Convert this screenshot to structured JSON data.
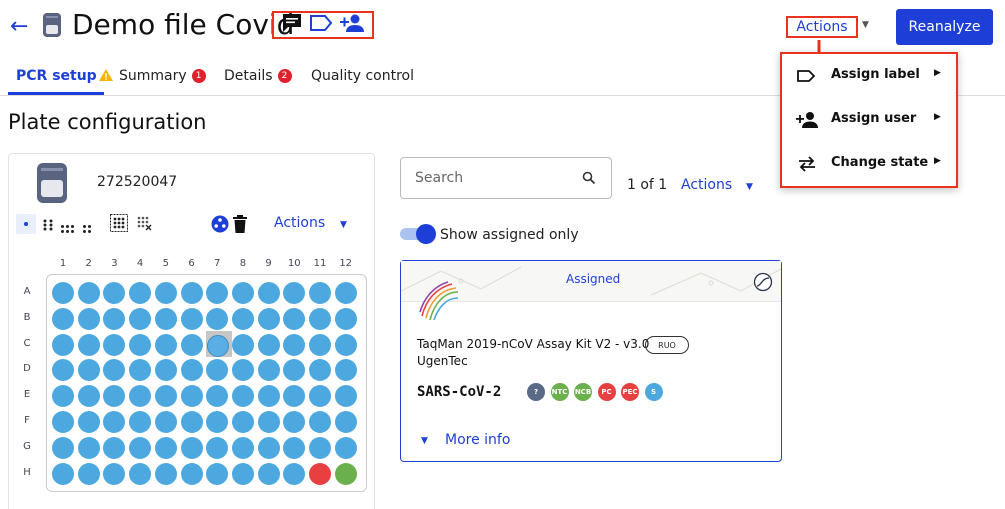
{
  "header": {
    "back_icon": "arrow-left-icon",
    "title": "Demo file Covid",
    "actions_label": "Actions",
    "reanalyze_label": "Reanalyze",
    "icons": [
      "comment-icon",
      "label-icon",
      "add-user-icon"
    ]
  },
  "tabs": [
    {
      "label": "PCR setup",
      "warning": true,
      "active": true
    },
    {
      "label": "Summary",
      "badge": "1"
    },
    {
      "label": "Details",
      "badge": "2"
    },
    {
      "label": "Quality control"
    }
  ],
  "section_title": "Plate configuration",
  "plate": {
    "id": "272520047",
    "actions_label": "Actions",
    "columns": [
      "1",
      "2",
      "3",
      "4",
      "5",
      "6",
      "7",
      "8",
      "9",
      "10",
      "11",
      "12"
    ],
    "rows": [
      "A",
      "B",
      "C",
      "D",
      "E",
      "F",
      "G",
      "H"
    ],
    "special_wells": {
      "selected": "C7",
      "red": "H11",
      "green": "H12"
    },
    "colors": {
      "well": "#4da8e0",
      "red": "#e84040",
      "green": "#6ab04c"
    }
  },
  "search": {
    "placeholder": "Search",
    "page_count": "1 of 1",
    "actions_label": "Actions"
  },
  "toggle": {
    "label": "Show assigned only",
    "on": true
  },
  "card": {
    "status": "Assigned",
    "kit_name": "TaqMan 2019-nCoV Assay Kit V2 - v3.0",
    "tag": "RUO",
    "vendor": "UgenTec",
    "target": "SARS-CoV-2",
    "controls": [
      {
        "label": "?",
        "color": "#5a6a86"
      },
      {
        "label": "NTC",
        "color": "#6ab04c"
      },
      {
        "label": "NCB",
        "color": "#6ab04c"
      },
      {
        "label": "PC",
        "color": "#e84040"
      },
      {
        "label": "PEC",
        "color": "#e84040"
      },
      {
        "label": "S",
        "color": "#4da8e0"
      }
    ],
    "more_info": "More info"
  },
  "dropdown": {
    "items": [
      {
        "label": "Assign label",
        "icon": "label-icon"
      },
      {
        "label": "Assign user",
        "icon": "add-user-icon"
      },
      {
        "label": "Change state",
        "icon": "swap-arrows-icon"
      }
    ]
  },
  "accent_color": "#1d3fd8",
  "highlight_color": "#e8331e"
}
